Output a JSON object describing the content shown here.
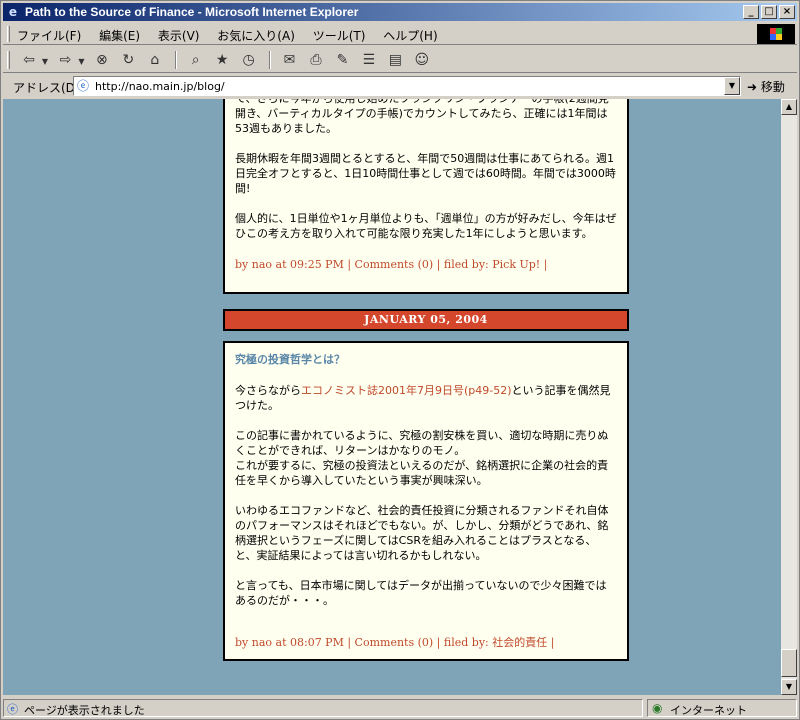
{
  "window": {
    "title": "Path to the Source of Finance - Microsoft Internet Explorer",
    "buttons": {
      "minimize": "_",
      "maximize": "□",
      "close": "×"
    }
  },
  "menu": {
    "items": [
      "ファイル(F)",
      "編集(E)",
      "表示(V)",
      "お気に入り(A)",
      "ツール(T)",
      "ヘルプ(H)"
    ]
  },
  "toolbar": {
    "icons": [
      "back-icon",
      "forward-icon",
      "stop-icon",
      "refresh-icon",
      "home-icon",
      "search-icon",
      "favorites-icon",
      "history-icon",
      "mail-icon",
      "print-icon",
      "edit-icon",
      "discuss-icon",
      "messenger-icon"
    ]
  },
  "address": {
    "label": "アドレス(D)",
    "url": "http://nao.main.jp/blog/",
    "go": "移動"
  },
  "posts": [
    {
      "paragraphs": [
        "て、さらに今年から使用し始めたフランクリン・プランナーの手帳(2週間見開き、バーティカルタイプの手帳)でカウントしてみたら、正確には1年間は53週もありました。",
        "長期休暇を年間3週間とるとすると、年間で50週間は仕事にあてられる。週1日完全オフとすると、1日10時間仕事として週では60時間。年間では3000時間!",
        "個人的に、1日単位や1ヶ月単位よりも、「週単位」の方が好みだし、今年はぜひこの考え方を取り入れて可能な限り充実した1年にしようと思います。"
      ],
      "meta": "by nao at 09:25 PM | Comments (0) | filed by: Pick Up! |"
    },
    {
      "date": "JANUARY 05, 2004",
      "title": "究極の投資哲学とは？",
      "intro_before": "今さらながら",
      "intro_link": "エコノミスト誌2001年7月9日号(p49-52)",
      "intro_after": "という記事を偶然見つけた。",
      "paragraphs": [
        "この記事に書かれているように、究極の割安株を買い、適切な時期に売りぬくことができれば、リターンはかなりのモノ。\nこれが要するに、究極の投資法といえるのだが、銘柄選択に企業の社会的責任を早くから導入していたという事実が興味深い。",
        "いわゆるエコファンドなど、社会的責任投資に分類されるファンドそれ自体のパフォーマンスはそれほどでもない。が、しかし、分類がどうであれ、銘柄選択というフェーズに関してはCSRを組み入れることはプラスとなる、と、実証結果によっては言い切れるかもしれない。",
        "と言っても、日本市場に関してはデータが出揃っていないので少々困難ではあるのだが・・・。"
      ],
      "meta": "by nao at 08:07 PM | Comments (0) | filed by: 社会的責任 |"
    }
  ],
  "status": {
    "text": "ページが表示されました",
    "zone": "インターネット"
  }
}
